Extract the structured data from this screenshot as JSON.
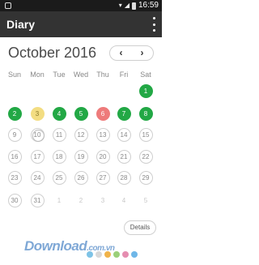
{
  "status_bar": {
    "time": "16:59"
  },
  "app_bar": {
    "title": "Diary"
  },
  "calendar": {
    "month_label": "October 2016",
    "prev_label": "‹",
    "next_label": "›",
    "weekdays": [
      "Sun",
      "Mon",
      "Tue",
      "Wed",
      "Thu",
      "Fri",
      "Sat"
    ],
    "weeks": [
      [
        {
          "n": "",
          "s": "none"
        },
        {
          "n": "",
          "s": "none"
        },
        {
          "n": "",
          "s": "none"
        },
        {
          "n": "",
          "s": "none"
        },
        {
          "n": "",
          "s": "none"
        },
        {
          "n": "",
          "s": "none"
        },
        {
          "n": "1",
          "s": "green"
        }
      ],
      [
        {
          "n": "2",
          "s": "green"
        },
        {
          "n": "3",
          "s": "yellow"
        },
        {
          "n": "4",
          "s": "green"
        },
        {
          "n": "5",
          "s": "green"
        },
        {
          "n": "6",
          "s": "red"
        },
        {
          "n": "7",
          "s": "green"
        },
        {
          "n": "8",
          "s": "green"
        }
      ],
      [
        {
          "n": "9",
          "s": "empty"
        },
        {
          "n": "10",
          "s": "today"
        },
        {
          "n": "11",
          "s": "empty"
        },
        {
          "n": "12",
          "s": "empty"
        },
        {
          "n": "13",
          "s": "empty"
        },
        {
          "n": "14",
          "s": "empty"
        },
        {
          "n": "15",
          "s": "empty"
        }
      ],
      [
        {
          "n": "16",
          "s": "empty"
        },
        {
          "n": "17",
          "s": "empty"
        },
        {
          "n": "18",
          "s": "empty"
        },
        {
          "n": "19",
          "s": "empty"
        },
        {
          "n": "20",
          "s": "empty"
        },
        {
          "n": "21",
          "s": "empty"
        },
        {
          "n": "22",
          "s": "empty"
        }
      ],
      [
        {
          "n": "23",
          "s": "empty"
        },
        {
          "n": "24",
          "s": "empty"
        },
        {
          "n": "25",
          "s": "empty"
        },
        {
          "n": "26",
          "s": "empty"
        },
        {
          "n": "27",
          "s": "empty"
        },
        {
          "n": "28",
          "s": "empty"
        },
        {
          "n": "29",
          "s": "empty"
        }
      ],
      [
        {
          "n": "30",
          "s": "empty"
        },
        {
          "n": "31",
          "s": "empty"
        },
        {
          "n": "1",
          "s": "other"
        },
        {
          "n": "2",
          "s": "other"
        },
        {
          "n": "3",
          "s": "other"
        },
        {
          "n": "4",
          "s": "other"
        },
        {
          "n": "5",
          "s": "other"
        }
      ]
    ]
  },
  "details_button": {
    "label": "Details"
  },
  "watermark": {
    "brand": "Download",
    "domain": ".com.vn",
    "dot_colors": [
      "#7ec3e6",
      "#d8d8d8",
      "#f0b34a",
      "#9bd07a",
      "#e58db0",
      "#6fb7e8"
    ]
  },
  "colors": {
    "green": "#22a845",
    "yellow": "#f3dd82",
    "red": "#ee7b7b",
    "appbar": "#333333"
  }
}
